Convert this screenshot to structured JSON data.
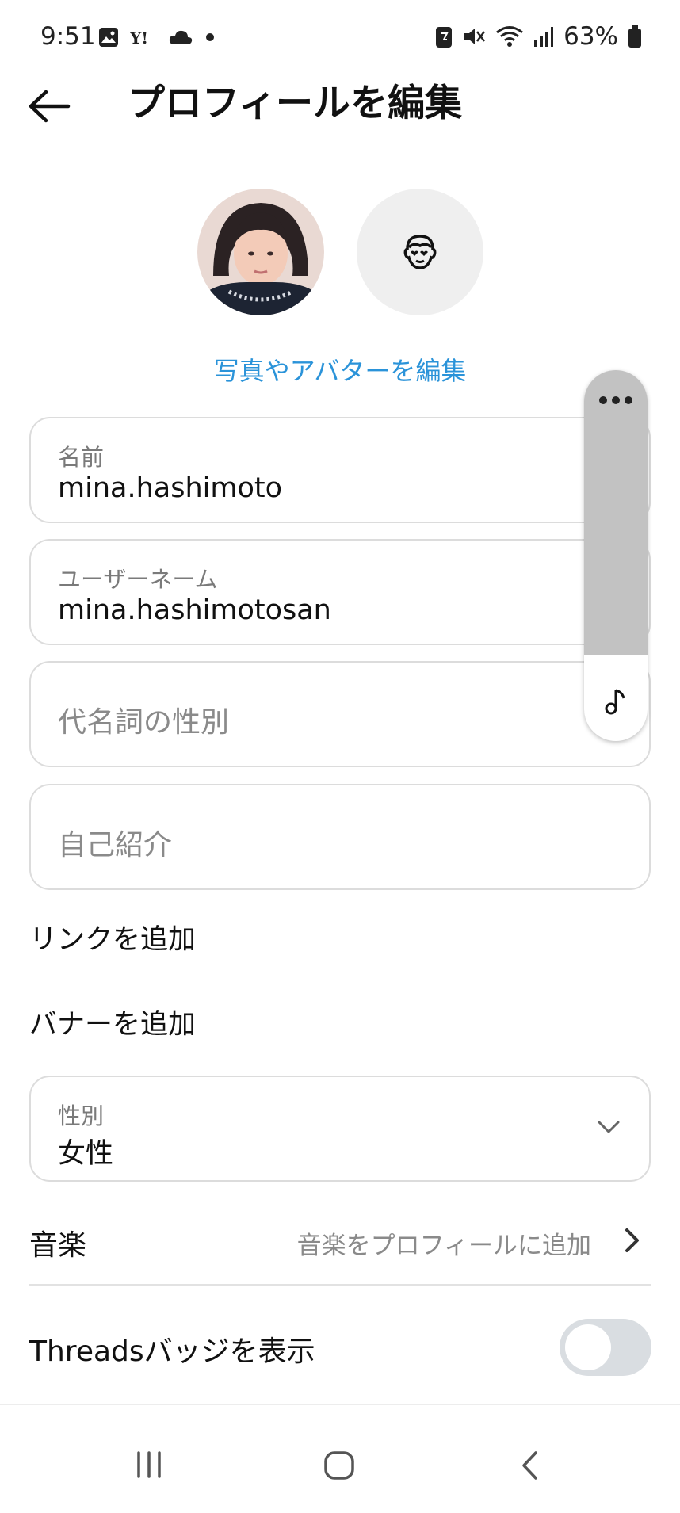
{
  "status_bar": {
    "time": "9:51",
    "battery": "63%",
    "left_icons": [
      "gallery-icon",
      "yahoo-icon",
      "cloud-icon",
      "dot-icon"
    ],
    "right_icons": [
      "nfc-icon",
      "mute-icon",
      "wifi-icon",
      "signal-icon",
      "battery-icon"
    ]
  },
  "header": {
    "title": "プロフィールを編集"
  },
  "profile": {
    "edit_photo_label": "写真やアバターを編集"
  },
  "fields": {
    "name": {
      "label": "名前",
      "value": "mina.hashimoto"
    },
    "username": {
      "label": "ユーザーネーム",
      "value": "mina.hashimotosan"
    },
    "pronouns": {
      "placeholder": "代名詞の性別"
    },
    "bio": {
      "placeholder": "自己紹介"
    },
    "gender": {
      "label": "性別",
      "value": "女性"
    }
  },
  "rows": {
    "add_link": "リンクを追加",
    "add_banner": "バナーを追加",
    "music_label": "音楽",
    "music_hint": "音楽をプロフィールに追加",
    "threads_badge": "Threadsバッジを表示"
  },
  "toggles": {
    "threads_badge_on": false
  },
  "colors": {
    "accent_link": "#2a93d9",
    "border": "#dcdcdc",
    "toggle_off": "#d9dde1"
  }
}
